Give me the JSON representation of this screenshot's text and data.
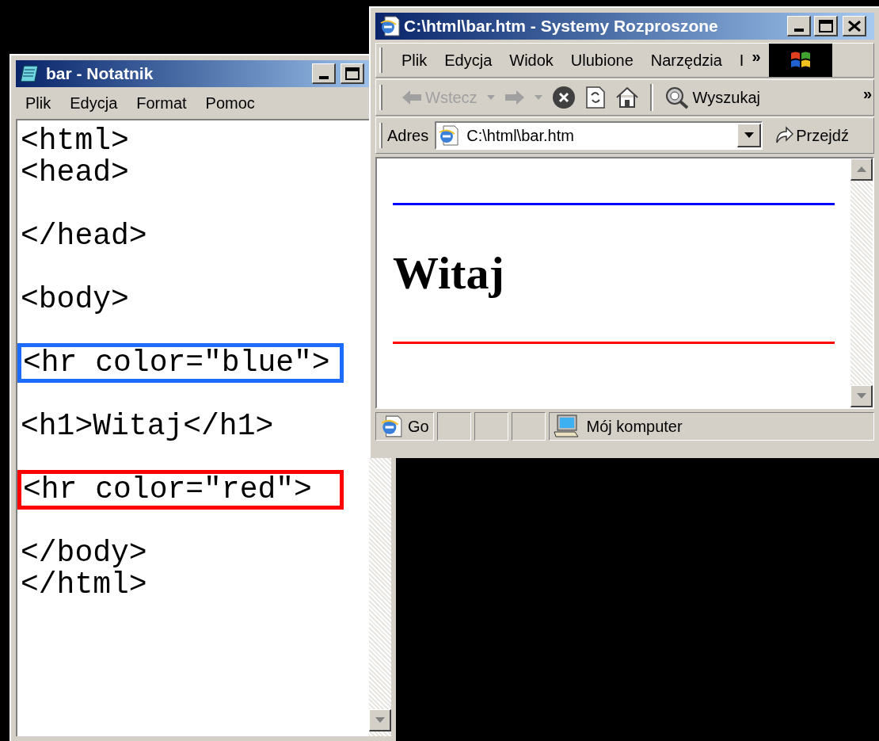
{
  "notepad": {
    "title": "bar - Notatnik",
    "menu": [
      "Plik",
      "Edycja",
      "Format",
      "Pomoc"
    ],
    "lines": [
      {
        "kind": "code",
        "text": "<html>"
      },
      {
        "kind": "code",
        "text": "<head>"
      },
      {
        "kind": "blank"
      },
      {
        "kind": "code",
        "text": "</head>"
      },
      {
        "kind": "blank"
      },
      {
        "kind": "code",
        "text": "<body>"
      },
      {
        "kind": "blank"
      },
      {
        "kind": "highlight",
        "text": "<hr color=\"blue\">",
        "color": "#1e6cff"
      },
      {
        "kind": "blank"
      },
      {
        "kind": "code",
        "text": "<h1>Witaj</h1>"
      },
      {
        "kind": "blank"
      },
      {
        "kind": "highlight",
        "text": "<hr color=\"red\">",
        "color": "#ff0000"
      },
      {
        "kind": "blank"
      },
      {
        "kind": "code",
        "text": "</body>"
      },
      {
        "kind": "code",
        "text": "</html>"
      }
    ]
  },
  "browser": {
    "title": "C:\\html\\bar.htm - Systemy Rozproszone",
    "menu": [
      "Plik",
      "Edycja",
      "Widok",
      "Ulubione",
      "Narzędzia",
      "I"
    ],
    "menu_more": "»",
    "toolbar": [
      {
        "kind": "back",
        "label": "Wstecz",
        "disabled": true
      },
      {
        "kind": "dropdown",
        "disabled": true
      },
      {
        "kind": "forward",
        "disabled": true
      },
      {
        "kind": "dropdown",
        "disabled": true
      },
      {
        "kind": "stop",
        "disabled": false
      },
      {
        "kind": "refresh",
        "disabled": false
      },
      {
        "kind": "home",
        "disabled": false
      },
      {
        "kind": "separator"
      },
      {
        "kind": "search",
        "label": "Wyszukaj",
        "disabled": false
      }
    ],
    "toolbar_more": "»",
    "address": {
      "label": "Adres",
      "value": "C:\\html\\bar.htm",
      "go": "Przejdź"
    },
    "page": [
      {
        "kind": "rule",
        "color": "#0000ff"
      },
      {
        "kind": "heading",
        "text": "Witaj"
      },
      {
        "kind": "rule",
        "color": "#ff0000"
      }
    ],
    "status_bar": {
      "text": "Go",
      "zone": "Mój komputer"
    }
  }
}
